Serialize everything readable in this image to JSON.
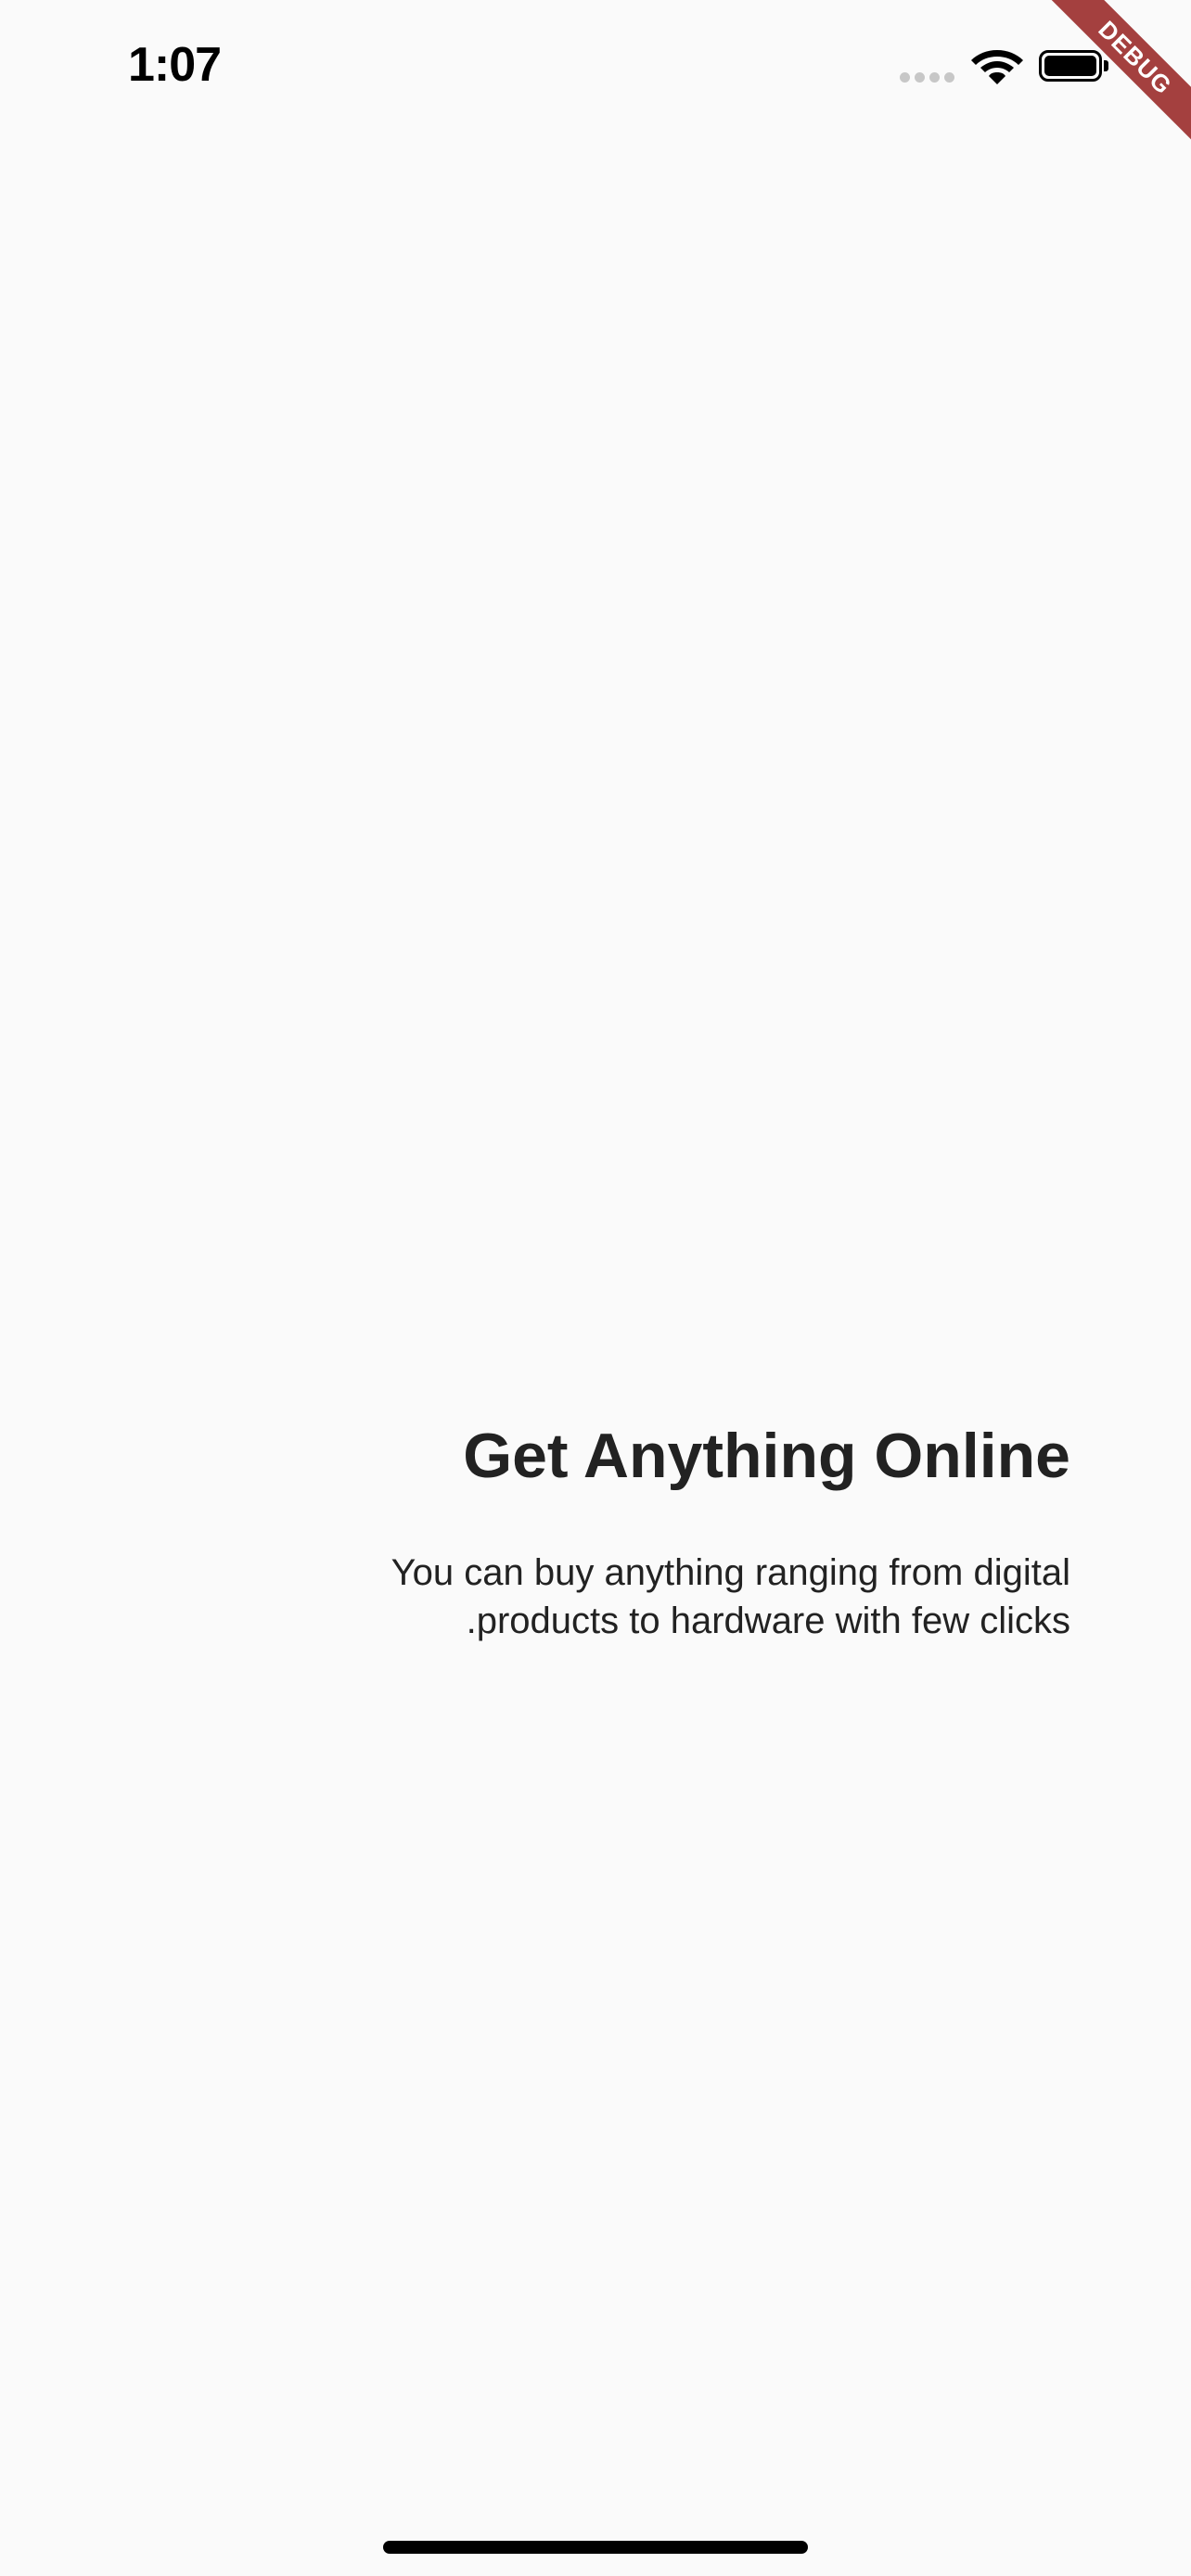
{
  "status_bar": {
    "time": "1:07",
    "signal_icon": "cellular-signal-icon",
    "wifi_icon": "wifi-icon",
    "battery_icon": "battery-icon"
  },
  "debug_banner": {
    "label": "DEBUG",
    "color": "#a4403f"
  },
  "onboarding": {
    "title": "Get Anything Online",
    "description_lines": [
      "You can buy anything ranging from digital",
      ".products to hardware with few clicks"
    ]
  },
  "colors": {
    "background": "#fafafa",
    "text": "#222222"
  }
}
